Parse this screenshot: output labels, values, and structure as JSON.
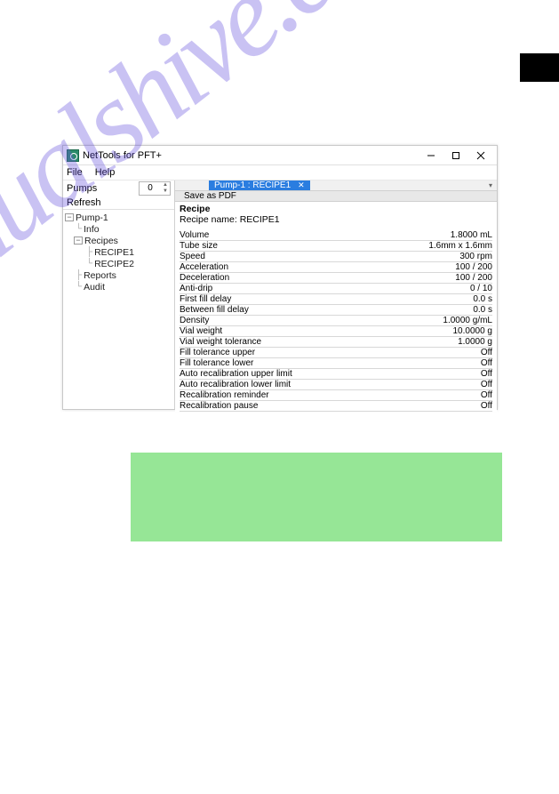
{
  "titlebar": {
    "title": "NetTools for PFT+"
  },
  "menubar": {
    "file": "File",
    "help": "Help"
  },
  "sidebar": {
    "pumps_label": "Pumps",
    "pumps_value": "0",
    "refresh": "Refresh",
    "tree": {
      "root": "Pump-1",
      "info": "Info",
      "recipes": "Recipes",
      "recipe1": "RECIPE1",
      "recipe2": "RECIPE2",
      "reports": "Reports",
      "audit": "Audit"
    }
  },
  "tab": {
    "label": "Pump-1 : RECIPE1",
    "save_pdf": "Save as PDF"
  },
  "recipe": {
    "heading": "Recipe",
    "name_label": "Recipe name: RECIPE1",
    "rows": [
      {
        "label": "Volume",
        "value": "1.8000 mL"
      },
      {
        "label": "Tube size",
        "value": "1.6mm x 1.6mm"
      },
      {
        "label": "Speed",
        "value": "300 rpm"
      },
      {
        "label": "Acceleration",
        "value": "100 / 200"
      },
      {
        "label": "Deceleration",
        "value": "100 / 200"
      },
      {
        "label": "Anti-drip",
        "value": "0 / 10"
      },
      {
        "label": "First fill delay",
        "value": "0.0 s"
      },
      {
        "label": "Between fill delay",
        "value": "0.0 s"
      },
      {
        "label": "Density",
        "value": "1.0000 g/mL"
      },
      {
        "label": "Vial weight",
        "value": "10.0000 g"
      },
      {
        "label": "Vial weight tolerance",
        "value": "1.0000 g"
      },
      {
        "label": "Fill tolerance upper",
        "value": "Off"
      },
      {
        "label": "Fill tolerance lower",
        "value": "Off"
      },
      {
        "label": "Auto recalibration upper limit",
        "value": "Off"
      },
      {
        "label": "Auto recalibration lower limit",
        "value": "Off"
      },
      {
        "label": "Recalibration reminder",
        "value": "Off"
      },
      {
        "label": "Recalibration pause",
        "value": "Off"
      }
    ]
  }
}
